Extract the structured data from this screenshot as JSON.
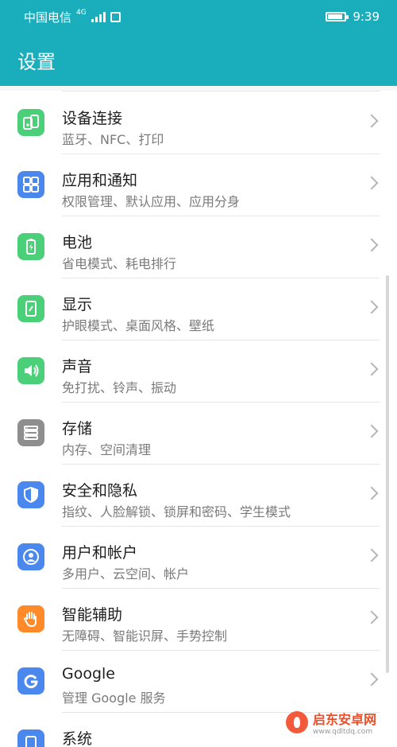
{
  "status_bar": {
    "carrier": "中国电信",
    "network": "4G",
    "time": "9:39"
  },
  "app_bar": {
    "title": "设置"
  },
  "colors": {
    "teal": "#1aaebc",
    "green": "#4ccf79",
    "blue": "#4a88ee",
    "gray": "#8e8e8e",
    "orange": "#ff8a2a",
    "google_blue": "#4a88ee"
  },
  "items": [
    {
      "title": "设备连接",
      "subtitle": "蓝牙、NFC、打印",
      "icon": "device-connect-icon",
      "color": "#4ccf79"
    },
    {
      "title": "应用和通知",
      "subtitle": "权限管理、默认应用、应用分身",
      "icon": "apps-icon",
      "color": "#4a88ee"
    },
    {
      "title": "电池",
      "subtitle": "省电模式、耗电排行",
      "icon": "battery-icon",
      "color": "#4ccf79"
    },
    {
      "title": "显示",
      "subtitle": "护眼模式、桌面风格、壁纸",
      "icon": "display-icon",
      "color": "#4ccf79"
    },
    {
      "title": "声音",
      "subtitle": "免打扰、铃声、振动",
      "icon": "sound-icon",
      "color": "#4ccf79"
    },
    {
      "title": "存储",
      "subtitle": "内存、空间清理",
      "icon": "storage-icon",
      "color": "#8e8e8e"
    },
    {
      "title": "安全和隐私",
      "subtitle": "指纹、人脸解锁、锁屏和密码、学生模式",
      "icon": "shield-icon",
      "color": "#4a88ee"
    },
    {
      "title": "用户和帐户",
      "subtitle": "多用户、云空间、帐户",
      "icon": "user-icon",
      "color": "#4a88ee"
    },
    {
      "title": "智能辅助",
      "subtitle": "无障碍、智能识屏、手势控制",
      "icon": "hand-icon",
      "color": "#ff8a2a"
    },
    {
      "title": "Google",
      "subtitle": "管理 Google 服务",
      "icon": "google-icon",
      "color": "#4a88ee"
    },
    {
      "title": "系统",
      "subtitle": "",
      "icon": "system-icon",
      "color": "#4a88ee"
    }
  ],
  "watermark": {
    "title": "启东安卓网",
    "url": "www.qdltdq.com"
  }
}
